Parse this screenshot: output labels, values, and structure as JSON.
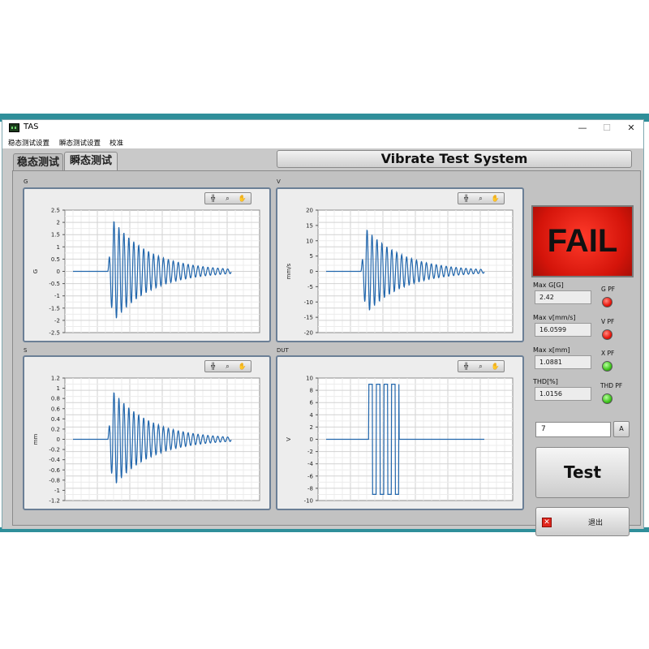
{
  "window": {
    "title": "TAS",
    "controls": {
      "minimize": "—",
      "maximize": "☐",
      "close": "✕"
    }
  },
  "menu": [
    "稳态测试设置",
    "瞬态测试设置",
    "校准"
  ],
  "tabs": [
    {
      "label": "稳态测试",
      "active": false
    },
    {
      "label": "瞬态测试",
      "active": true
    }
  ],
  "banner": "Vibrate Test System",
  "status": {
    "text": "FAIL",
    "color": "#e8160c"
  },
  "measurements": [
    {
      "label": "Max G[G]",
      "value": "2.42",
      "pf_label": "G PF",
      "pf_state": "red"
    },
    {
      "label": "Max v[mm/s]",
      "value": "16.0599",
      "pf_label": "V PF",
      "pf_state": "red"
    },
    {
      "label": "Max x[mm]",
      "value": "1.0881",
      "pf_label": "X PF",
      "pf_state": "green"
    },
    {
      "label": "THD[%]",
      "value": "1.0156",
      "pf_label": "THD PF",
      "pf_state": "green"
    }
  ],
  "input_value": "7",
  "input_button": "A",
  "test_button": "Test",
  "exit_button": "退出",
  "chart_data": [
    {
      "type": "line",
      "title": "G",
      "ylabel": "G",
      "ylim": [
        -2.5,
        2.5
      ],
      "yticks": [
        "2.5",
        "2",
        "1.5",
        "1",
        "0.5",
        "0",
        "-0.5",
        "-1",
        "-1.5",
        "-2",
        "-2.5"
      ],
      "signal": "decaying oscillation after impulse",
      "peak": 2.42,
      "series_color": "#2166ac"
    },
    {
      "type": "line",
      "title": "V",
      "ylabel": "mm/s",
      "ylim": [
        -20,
        20
      ],
      "yticks": [
        "20",
        "15",
        "10",
        "5",
        "0",
        "-5",
        "-10",
        "-15",
        "-20"
      ],
      "signal": "decaying oscillation after impulse",
      "peak": 16.06,
      "series_color": "#2166ac"
    },
    {
      "type": "line",
      "title": "S",
      "ylabel": "mm",
      "ylim": [
        -1.2,
        1.2
      ],
      "yticks": [
        "1.2",
        "1",
        "0.8",
        "0.6",
        "0.4",
        "0.2",
        "0",
        "-0.2",
        "-0.4",
        "-0.6",
        "-0.8",
        "-1",
        "-1.2"
      ],
      "signal": "decaying oscillation after impulse",
      "peak": 1.09,
      "series_color": "#2166ac"
    },
    {
      "type": "line",
      "title": "DUT",
      "ylabel": "V",
      "ylim": [
        -10,
        10
      ],
      "yticks": [
        "10",
        "8",
        "6",
        "4",
        "2",
        "0",
        "-2",
        "-4",
        "-6",
        "-8",
        "-10"
      ],
      "signal": "burst of square pulses",
      "peak": 9,
      "series_color": "#2166ac"
    }
  ]
}
